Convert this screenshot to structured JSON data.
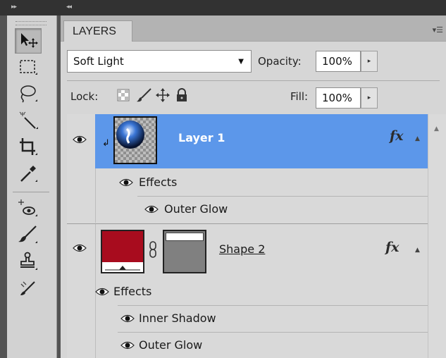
{
  "panel": {
    "tab_label": "LAYERS",
    "menu_icon": "panel-menu-icon"
  },
  "controls": {
    "blend_mode": "Soft Light",
    "opacity_label": "Opacity:",
    "opacity_value": "100%",
    "lock_label": "Lock:",
    "fill_label": "Fill:",
    "fill_value": "100%"
  },
  "layers": [
    {
      "name": "Layer 1",
      "selected": true,
      "fx_label": "fx",
      "effects_label": "Effects",
      "effects": [
        "Outer Glow"
      ]
    },
    {
      "name": "Shape 2",
      "selected": false,
      "fx_label": "fx",
      "effects_label": "Effects",
      "effects": [
        "Inner Shadow",
        "Outer Glow"
      ],
      "fill_color": "#a80c1e"
    }
  ],
  "colors": {
    "selection": "#5c97ea",
    "panel_bg": "#d6d6d6",
    "dark_bar": "#323232"
  },
  "tools": [
    "move-tool",
    "marquee-tool",
    "lasso-tool",
    "magic-wand-tool",
    "crop-tool",
    "eyedropper-tool",
    "healing-brush-tool",
    "brush-tool",
    "clone-stamp-tool",
    "history-brush-tool"
  ]
}
